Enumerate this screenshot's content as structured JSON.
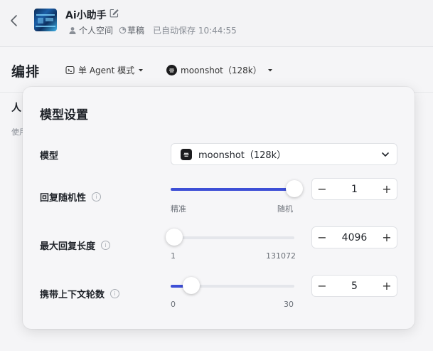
{
  "app": {
    "title": "Ai小助手",
    "workspace": "个人空间",
    "status": "草稿",
    "saved": "已自动保存 10:44:55"
  },
  "header": {
    "title": "编排",
    "mode": "单 Agent 模式",
    "model": "moonshot（128k）"
  },
  "background": {
    "section": "人",
    "hint": "使用"
  },
  "panel": {
    "title": "模型设置",
    "model_label": "模型",
    "model_value": "moonshot（128k）",
    "temperature": {
      "label": "回复随机性",
      "min_label": "精准",
      "max_label": "随机",
      "value": "1",
      "fraction": 1.0
    },
    "max_length": {
      "label": "最大回复长度",
      "min_label": "1",
      "max_label": "131072",
      "value": "4096",
      "fraction": 0.03
    },
    "context_rounds": {
      "label": "携带上下文轮数",
      "min_label": "0",
      "max_label": "30",
      "value": "5",
      "fraction": 0.167
    }
  },
  "icons": {
    "back": "chevron-left-icon",
    "edit": "edit-icon",
    "user": "user-icon",
    "draft": "draft-icon",
    "mode": "agent-mode-icon",
    "caret": "caret-down-icon",
    "model_logo": "moonshot-logo-icon",
    "info": "info-icon"
  },
  "colors": {
    "accent": "#3d4fd6",
    "panel_bg": "#f6f6f8"
  }
}
